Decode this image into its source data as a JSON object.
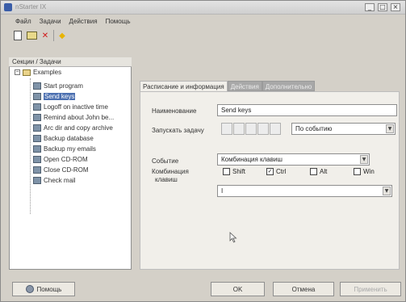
{
  "window": {
    "title": "nStarter IX"
  },
  "menu": [
    "Файл",
    "Задачи",
    "Действия",
    "Помощь"
  ],
  "toolbar": {
    "icons": [
      "new-icon",
      "open-icon",
      "delete-icon",
      "run-icon"
    ]
  },
  "tree": {
    "header": "Секции / Задачи",
    "root": "Examples",
    "items": [
      "Start program",
      "Send keys",
      "Logoff on inactive time",
      "Remind about John be...",
      "Arc dir and copy archive",
      "Backup database",
      "Backup my emails",
      "Open CD-ROM",
      "Close CD-ROM",
      "Check mail"
    ],
    "selected_index": 1
  },
  "tabs": [
    "Расписание и информация",
    "Действия",
    "Дополнительно"
  ],
  "form": {
    "name_label": "Наименование",
    "name_value": "Send keys",
    "run_label": "Запускать задачу",
    "run_value": "По событию",
    "event_label": "Событие",
    "event_value": "Комбинация клавиш",
    "combo_label_1": "Комбинация",
    "combo_label_2": "клавиш",
    "modifiers": [
      {
        "label": "Shift",
        "checked": false
      },
      {
        "label": "Ctrl",
        "checked": true
      },
      {
        "label": "Alt",
        "checked": false
      },
      {
        "label": "Win",
        "checked": false
      }
    ],
    "key_value": "I"
  },
  "buttons": {
    "help": "Помощь",
    "ok": "OK",
    "cancel": "Отмена",
    "apply": "Применить"
  }
}
